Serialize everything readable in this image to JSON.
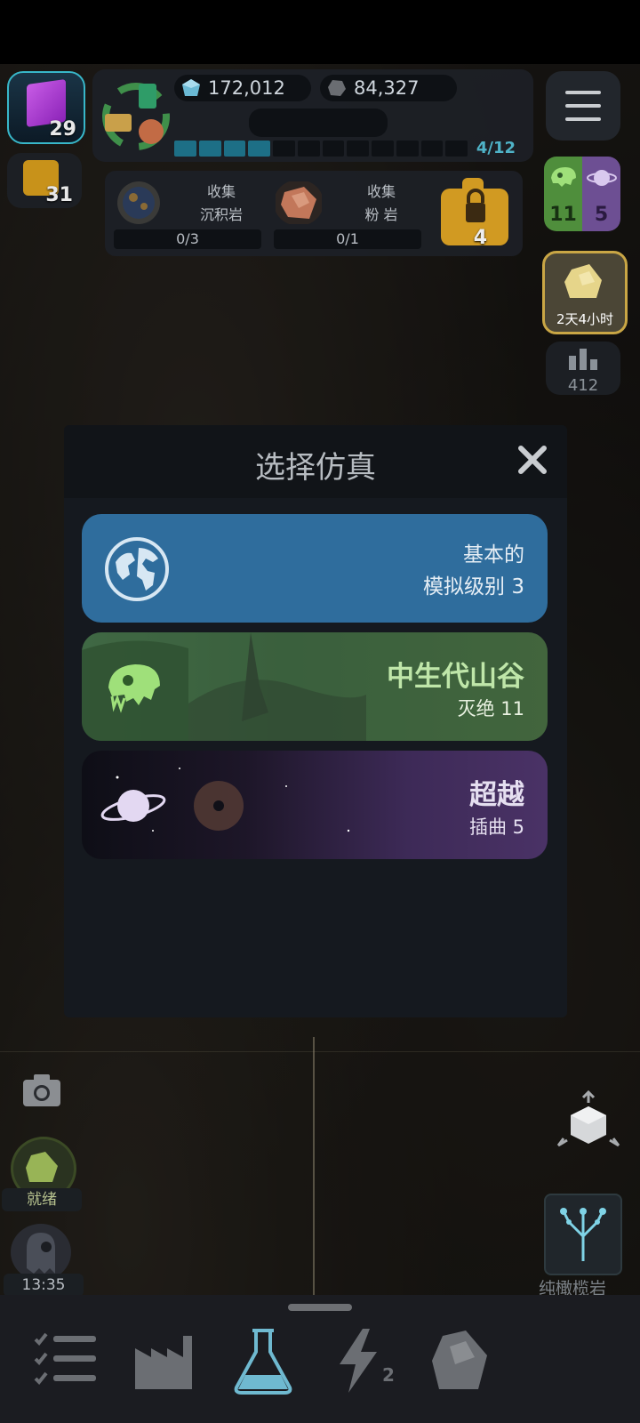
{
  "hud": {
    "cube_count": "29",
    "puzzle_count": "31",
    "crystal_amount": "172,012",
    "stone_amount": "84,327",
    "progress_label": "4/12",
    "progress_filled": 4,
    "progress_total": 12
  },
  "quests": [
    {
      "title": "收集",
      "name": "沉积岩",
      "progress": "0/3"
    },
    {
      "title": "收集",
      "name": "粉 岩",
      "progress": "0/1"
    }
  ],
  "locked_count": "4",
  "side": {
    "green_count": "11",
    "purple_count": "5",
    "timer": "2天4小时",
    "stats": "412"
  },
  "modal": {
    "title": "选择仿真",
    "cards": [
      {
        "line1": "基本的",
        "line2": "模拟级别 3"
      },
      {
        "line1": "中生代山谷",
        "line2": "灭绝 11"
      },
      {
        "line1": "超越",
        "line2": "插曲 5"
      }
    ]
  },
  "bottom_left": {
    "ready_label": "就绪",
    "time_label": "13:35"
  },
  "bottom_right": {
    "tree_label": "纯橄榄岩"
  },
  "nav": {
    "energy_badge": "2",
    "items": [
      "tasks-icon",
      "factory-icon",
      "flask-icon",
      "lightning-icon",
      "rock-icon"
    ]
  },
  "colors": {
    "accent_teal": "#38b7c9",
    "card_blue": "#2f6d9d",
    "card_green": "#46704a",
    "card_purple": "#3d2a57"
  }
}
